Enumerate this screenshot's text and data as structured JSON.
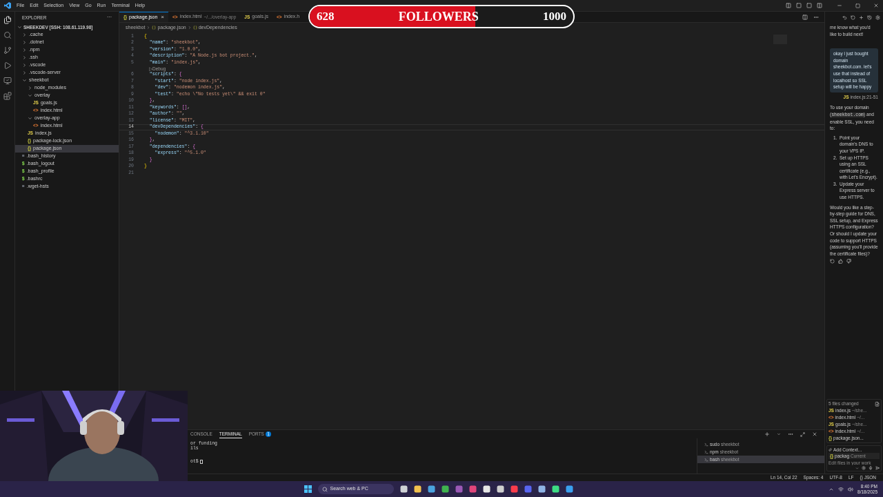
{
  "menu": [
    "File",
    "Edit",
    "Selection",
    "View",
    "Go",
    "Run",
    "Terminal",
    "Help"
  ],
  "explorer": {
    "title": "EXPLORER",
    "more": "···",
    "root": "SHEEKDEV [SSH: 108.61.119.98]",
    "items": [
      {
        "label": ".cache",
        "kind": "folder",
        "expanded": false,
        "selected": false
      },
      {
        "label": ".dotnet",
        "kind": "folder",
        "expanded": false,
        "selected": false
      },
      {
        "label": ".npm",
        "kind": "folder",
        "expanded": false,
        "selected": false
      },
      {
        "label": ".ssh",
        "kind": "folder",
        "expanded": false,
        "selected": false
      },
      {
        "label": ".vscode",
        "kind": "folder",
        "expanded": false,
        "selected": false
      },
      {
        "label": ".vscode-server",
        "kind": "folder",
        "expanded": false,
        "selected": false
      },
      {
        "label": "sheekbot",
        "kind": "folder",
        "expanded": true,
        "selected": false,
        "children": [
          {
            "label": "node_modules",
            "kind": "folder",
            "expanded": false,
            "selected": false
          },
          {
            "label": "overlay",
            "kind": "folder",
            "expanded": true,
            "selected": false,
            "children": [
              {
                "label": "goals.js",
                "kind": "js",
                "icon": "JS",
                "selected": false
              },
              {
                "label": "index.html",
                "kind": "html",
                "icon": "<>",
                "selected": false
              }
            ]
          },
          {
            "label": "overlay-app",
            "kind": "folder",
            "expanded": true,
            "selected": false,
            "children": [
              {
                "label": "index.html",
                "kind": "html",
                "icon": "<>",
                "selected": false
              }
            ]
          },
          {
            "label": "index.js",
            "kind": "js",
            "icon": "JS",
            "selected": false
          },
          {
            "label": "package-lock.json",
            "kind": "json",
            "icon": "{}",
            "selected": false
          },
          {
            "label": "package.json",
            "kind": "json",
            "icon": "{}",
            "selected": true
          }
        ]
      },
      {
        "label": ".bash_history",
        "kind": "text",
        "icon": "≡",
        "selected": false
      },
      {
        "label": ".bash_logout",
        "kind": "shell",
        "icon": "$",
        "selected": false
      },
      {
        "label": ".bash_profile",
        "kind": "shell",
        "icon": "$",
        "selected": false
      },
      {
        "label": ".bashrc",
        "kind": "shell",
        "icon": "$",
        "selected": false
      },
      {
        "label": ".wget-hsts",
        "kind": "text",
        "icon": "≡",
        "selected": false
      }
    ]
  },
  "tabs": [
    {
      "label": "package.json",
      "kind": "json",
      "icon": "{}",
      "selected": true,
      "close": "×"
    },
    {
      "label": "index.html",
      "hint": "~/.../overlay-app",
      "kind": "html",
      "icon": "<>",
      "selected": false
    },
    {
      "label": "goals.js",
      "kind": "js",
      "icon": "JS",
      "selected": false
    },
    {
      "label": "index.h",
      "kind": "html",
      "icon": "<>",
      "selected": false
    }
  ],
  "breadcrumb": [
    "sheekbot",
    "package.json",
    "devDependencies"
  ],
  "code": [
    {
      "kind": "line",
      "n": "1",
      "current": false,
      "segs": [
        {
          "text": "{",
          "kind": "bracket"
        }
      ]
    },
    {
      "kind": "line",
      "n": "2",
      "current": false,
      "segs": [
        {
          "text": "  \"name\"",
          "kind": "key"
        },
        {
          "text": ": ",
          "kind": "punct"
        },
        {
          "text": "\"sheekbot\"",
          "kind": "string"
        },
        {
          "text": ",",
          "kind": "punct"
        }
      ]
    },
    {
      "kind": "line",
      "n": "3",
      "current": false,
      "segs": [
        {
          "text": "  \"version\"",
          "kind": "key"
        },
        {
          "text": ": ",
          "kind": "punct"
        },
        {
          "text": "\"1.0.0\"",
          "kind": "string"
        },
        {
          "text": ",",
          "kind": "punct"
        }
      ]
    },
    {
      "kind": "line",
      "n": "4",
      "current": false,
      "segs": [
        {
          "text": "  \"description\"",
          "kind": "key"
        },
        {
          "text": ": ",
          "kind": "punct"
        },
        {
          "text": "\"A Node.js bot project.\"",
          "kind": "string"
        },
        {
          "text": ",",
          "kind": "punct"
        }
      ]
    },
    {
      "kind": "line",
      "n": "5",
      "current": false,
      "segs": [
        {
          "text": "  \"main\"",
          "kind": "key"
        },
        {
          "text": ": ",
          "kind": "punct"
        },
        {
          "text": "\"index.js\"",
          "kind": "string"
        },
        {
          "text": ",",
          "kind": "punct"
        }
      ]
    },
    {
      "kind": "codelens",
      "text": "▷Debug"
    },
    {
      "kind": "line",
      "n": "6",
      "current": false,
      "segs": [
        {
          "text": "  \"scripts\"",
          "kind": "key"
        },
        {
          "text": ": ",
          "kind": "punct"
        },
        {
          "text": "{",
          "kind": "bracket2"
        }
      ]
    },
    {
      "kind": "line",
      "n": "7",
      "current": false,
      "segs": [
        {
          "text": "    \"start\"",
          "kind": "key"
        },
        {
          "text": ": ",
          "kind": "punct"
        },
        {
          "text": "\"node index.js\"",
          "kind": "string"
        },
        {
          "text": ",",
          "kind": "punct"
        }
      ]
    },
    {
      "kind": "line",
      "n": "8",
      "current": false,
      "segs": [
        {
          "text": "    \"dev\"",
          "kind": "key"
        },
        {
          "text": ": ",
          "kind": "punct"
        },
        {
          "text": "\"nodemon index.js\"",
          "kind": "string"
        },
        {
          "text": ",",
          "kind": "punct"
        }
      ]
    },
    {
      "kind": "line",
      "n": "9",
      "current": false,
      "segs": [
        {
          "text": "    \"test\"",
          "kind": "key"
        },
        {
          "text": ": ",
          "kind": "punct"
        },
        {
          "text": "\"echo \\\"No tests yet\\\" && exit 0\"",
          "kind": "string"
        }
      ]
    },
    {
      "kind": "line",
      "n": "10",
      "current": false,
      "segs": [
        {
          "text": "  }",
          "kind": "bracket2"
        },
        {
          "text": ",",
          "kind": "punct"
        }
      ]
    },
    {
      "kind": "line",
      "n": "11",
      "current": false,
      "segs": [
        {
          "text": "  \"keywords\"",
          "kind": "key"
        },
        {
          "text": ": ",
          "kind": "punct"
        },
        {
          "text": "[]",
          "kind": "bracket2"
        },
        {
          "text": ",",
          "kind": "punct"
        }
      ]
    },
    {
      "kind": "line",
      "n": "12",
      "current": false,
      "segs": [
        {
          "text": "  \"author\"",
          "kind": "key"
        },
        {
          "text": ": ",
          "kind": "punct"
        },
        {
          "text": "\"\"",
          "kind": "string"
        },
        {
          "text": ",",
          "kind": "punct"
        }
      ]
    },
    {
      "kind": "line",
      "n": "13",
      "current": false,
      "segs": [
        {
          "text": "  \"license\"",
          "kind": "key"
        },
        {
          "text": ": ",
          "kind": "punct"
        },
        {
          "text": "\"MIT\"",
          "kind": "string"
        },
        {
          "text": ",",
          "kind": "punct"
        }
      ]
    },
    {
      "kind": "line",
      "n": "14",
      "current": true,
      "segs": [
        {
          "text": "  \"devDependencies\"",
          "kind": "key"
        },
        {
          "text": ": ",
          "kind": "punct"
        },
        {
          "text": "{",
          "kind": "bracket2"
        }
      ]
    },
    {
      "kind": "line",
      "n": "15",
      "current": false,
      "segs": [
        {
          "text": "    \"nodemon\"",
          "kind": "key"
        },
        {
          "text": ": ",
          "kind": "punct"
        },
        {
          "text": "\"^3.1.10\"",
          "kind": "string"
        }
      ]
    },
    {
      "kind": "line",
      "n": "16",
      "current": false,
      "segs": [
        {
          "text": "  }",
          "kind": "bracket2"
        },
        {
          "text": ",",
          "kind": "punct"
        }
      ]
    },
    {
      "kind": "line",
      "n": "17",
      "current": false,
      "segs": [
        {
          "text": "  \"dependencies\"",
          "kind": "key"
        },
        {
          "text": ": ",
          "kind": "punct"
        },
        {
          "text": "{",
          "kind": "bracket2"
        }
      ]
    },
    {
      "kind": "line",
      "n": "18",
      "current": false,
      "segs": [
        {
          "text": "    \"express\"",
          "kind": "key"
        },
        {
          "text": ": ",
          "kind": "punct"
        },
        {
          "text": "\"^5.1.0\"",
          "kind": "string"
        }
      ]
    },
    {
      "kind": "line",
      "n": "19",
      "current": false,
      "segs": [
        {
          "text": "  }",
          "kind": "bracket2"
        }
      ]
    },
    {
      "kind": "line",
      "n": "20",
      "current": false,
      "segs": [
        {
          "text": "}",
          "kind": "bracket"
        }
      ]
    },
    {
      "kind": "line",
      "n": "21",
      "current": false
    }
  ],
  "overlay": {
    "current": "628",
    "label": "FOLLOWERS",
    "goal": "1000",
    "level": 0.628
  },
  "chat": {
    "intro": "me know what you'd like to build next!",
    "user_message": "okay i just bought domain sheekbot.com. let's use that instead of localhost so SSL setup will be happy",
    "reference": {
      "icon": "JS",
      "text": "index.js:21-51"
    },
    "answer_before": "To use your domain (",
    "answer_code": "sheekbot.com",
    "answer_after": ") and enable SSL, you need to:",
    "steps": [
      {
        "n": "1.",
        "text": "Point your domain's DNS to your VPS IP."
      },
      {
        "n": "2.",
        "text": "Set up HTTPS using an SSL certificate (e.g., with Let's Encrypt)."
      },
      {
        "n": "3.",
        "text": "Update your Express server to use HTTPS."
      }
    ],
    "question": "Would you like a step-by-step guide for DNS, SSL setup, and Express HTTPS configuration? Or should I update your code to support HTTPS (assuming you'll provide the certificate files)?",
    "changes": {
      "title": "5 files changed",
      "files": [
        {
          "icon": "JS",
          "kind": "js",
          "name": "index.js",
          "path": "~/she..."
        },
        {
          "icon": "<>",
          "kind": "html",
          "name": "index.html",
          "path": "~/..."
        },
        {
          "icon": "JS",
          "kind": "js",
          "name": "goals.js",
          "path": "~/she..."
        },
        {
          "icon": "<>",
          "kind": "html",
          "name": "index.html",
          "path": "~/..."
        },
        {
          "icon": "{}",
          "kind": "json",
          "name": "package.json..."
        }
      ]
    },
    "add_context": "Add Context...",
    "context_chip": {
      "icon": "{}",
      "name": "packag",
      "tag": "Current"
    },
    "placeholder": "Edit files in your work"
  },
  "panel": {
    "tabs": [
      {
        "label": "CONSOLE",
        "selected": false
      },
      {
        "label": "TERMINAL",
        "selected": true
      },
      {
        "label": "PORTS",
        "selected": false,
        "badge": "1"
      }
    ],
    "lines": [
      "or funding",
      "ils"
    ],
    "prompt": "ot$",
    "terminals": [
      {
        "name": "sudo",
        "host": "sheekbot",
        "selected": false
      },
      {
        "name": "npm",
        "host": "sheekbot",
        "selected": false
      },
      {
        "name": "bash",
        "host": "sheekbot",
        "selected": true
      }
    ]
  },
  "status": [
    "Ln 14, Col 22",
    "Spaces: 4",
    "UTF-8",
    "LF",
    "{} JSON"
  ],
  "taskbar": {
    "search": "Search web & PC",
    "time": "8:40 PM",
    "date": "8/18/2025"
  }
}
